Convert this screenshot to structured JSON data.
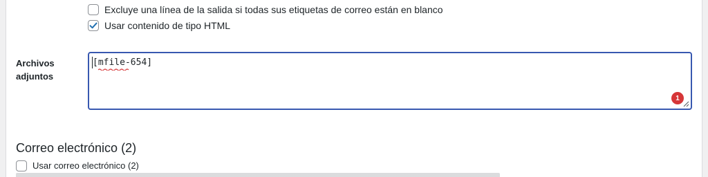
{
  "options": {
    "exclude_blank": {
      "label": "Excluye una línea de la salida si todas sus etiquetas de correo están en blanco",
      "checked": false
    },
    "use_html": {
      "label": "Usar contenido de tipo HTML",
      "checked": true
    }
  },
  "attachments": {
    "label": "Archivos adjuntos",
    "value": "[mfile-654]",
    "notification_count": "1"
  },
  "mail2": {
    "title": "Correo electrónico (2)",
    "use_label": "Usar correo electrónico (2)",
    "checked": false
  },
  "colors": {
    "focus_border": "#3858b0",
    "badge": "#d63638",
    "check": "#2271b1"
  }
}
